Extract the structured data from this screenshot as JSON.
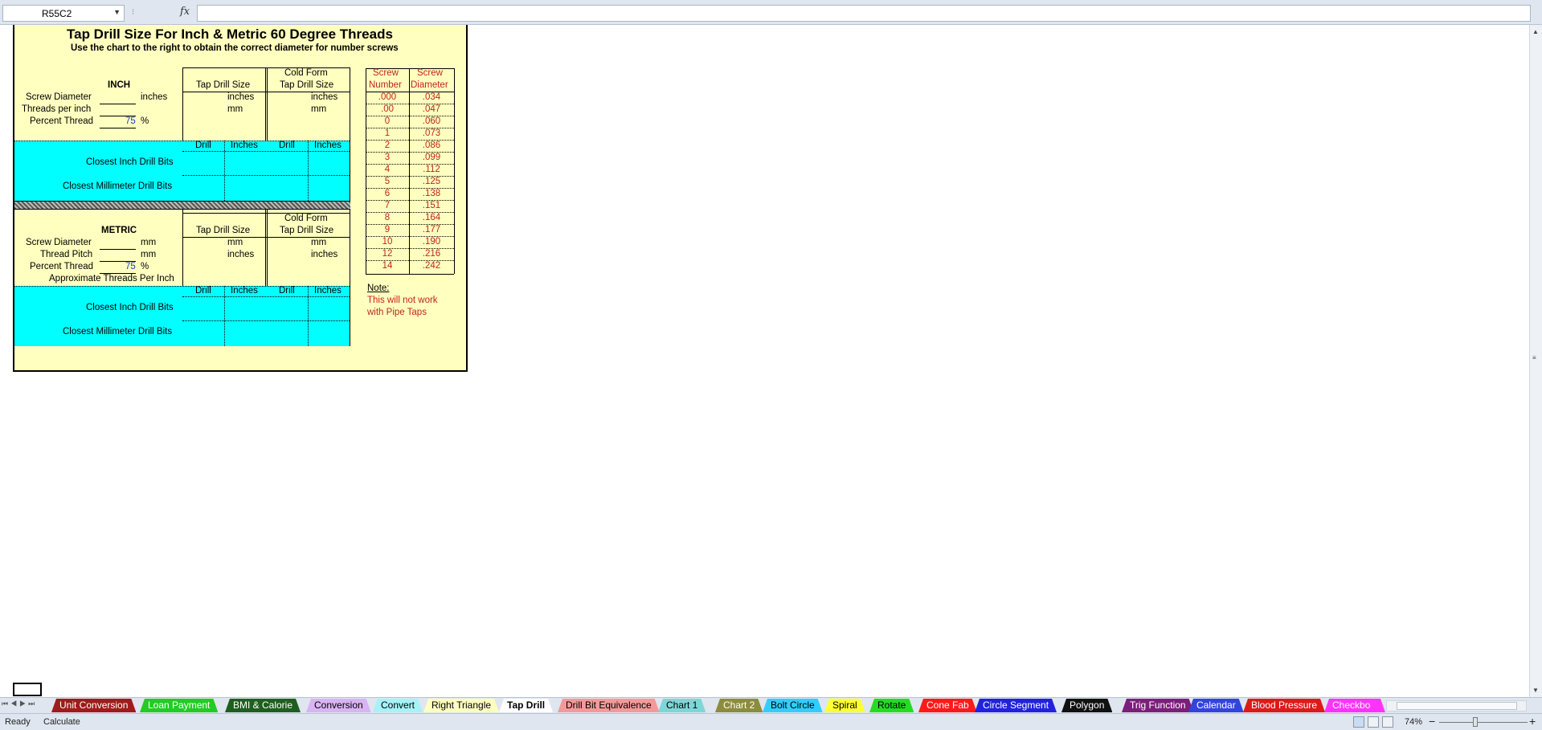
{
  "formula_bar": {
    "name_box": "R55C2",
    "fx_label": "fx",
    "formula": ""
  },
  "sheet": {
    "title": "Tap Drill Size For Inch & Metric 60 Degree Threads",
    "subtitle": "Use the chart to the right to obtain the correct diameter for number screws",
    "inch": {
      "heading": "INCH",
      "screw_diameter_label": "Screw Diameter",
      "screw_diameter_unit": "inches",
      "threads_per_inch_label": "Threads per inch",
      "percent_thread_label": "Percent Thread",
      "percent_thread_value": "75",
      "percent_unit": "%",
      "col_tap_drill": "Tap Drill Size",
      "col_cold_form_1": "Cold Form",
      "col_cold_form_2": "Tap Drill Size",
      "tap_unit_1": "inches",
      "tap_unit_2": "mm",
      "cold_unit_1": "inches",
      "cold_unit_2": "mm",
      "drill": "Drill",
      "inches": "Inches",
      "closest_inch": "Closest Inch Drill Bits",
      "closest_mm": "Closest Millimeter Drill Bits"
    },
    "metric": {
      "heading": "METRIC",
      "screw_diameter_label": "Screw Diameter",
      "screw_diameter_unit": "mm",
      "thread_pitch_label": "Thread Pitch",
      "thread_pitch_unit": "mm",
      "percent_thread_label": "Percent Thread",
      "percent_thread_value": "75",
      "percent_unit": "%",
      "approx_tpi": "Approximate Threads Per Inch",
      "col_tap_drill": "Tap Drill Size",
      "col_cold_form_1": "Cold Form",
      "col_cold_form_2": "Tap Drill Size",
      "tap_unit_1": "mm",
      "tap_unit_2": "inches",
      "cold_unit_1": "mm",
      "cold_unit_2": "inches",
      "drill": "Drill",
      "inches": "Inches",
      "closest_inch": "Closest Inch Drill Bits",
      "closest_mm": "Closest Millimeter Drill Bits"
    },
    "screw_table": {
      "header_number_1": "Screw",
      "header_number_2": "Number",
      "header_diameter_1": "Screw",
      "header_diameter_2": "Diameter",
      "rows": [
        {
          "number": ".000",
          "diameter": ".034"
        },
        {
          "number": ".00",
          "diameter": ".047"
        },
        {
          "number": "0",
          "diameter": ".060"
        },
        {
          "number": "1",
          "diameter": ".073"
        },
        {
          "number": "2",
          "diameter": ".086"
        },
        {
          "number": "3",
          "diameter": ".099"
        },
        {
          "number": "4",
          "diameter": ".112"
        },
        {
          "number": "5",
          "diameter": ".125"
        },
        {
          "number": "6",
          "diameter": ".138"
        },
        {
          "number": "7",
          "diameter": ".151"
        },
        {
          "number": "8",
          "diameter": ".164"
        },
        {
          "number": "9",
          "diameter": ".177"
        },
        {
          "number": "10",
          "diameter": ".190"
        },
        {
          "number": "12",
          "diameter": ".216"
        },
        {
          "number": "14",
          "diameter": ".242"
        }
      ]
    },
    "note_label": "Note:",
    "note_line_1": "This will not work",
    "note_line_2": "with Pipe Taps"
  },
  "tabs": [
    {
      "label": "Unit Conversion",
      "bg": "#a01b1b",
      "fg": "#ffffff"
    },
    {
      "label": "Loan Payment",
      "bg": "#22cc22",
      "fg": "#ffffff"
    },
    {
      "label": "BMI & Calorie",
      "bg": "#1f5e1f",
      "fg": "#ffffff"
    },
    {
      "label": "Conversion",
      "bg": "#d9b3f2",
      "fg": "#000000"
    },
    {
      "label": "Convert",
      "bg": "#a6f2f7",
      "fg": "#000000"
    },
    {
      "label": "Right Triangle",
      "bg": "#ffffc0",
      "fg": "#000000"
    },
    {
      "label": "Tap Drill",
      "bg": "#ffffff",
      "fg": "#000000",
      "active": true
    },
    {
      "label": "Drill Bit Equivalence",
      "bg": "#f29a9a",
      "fg": "#000000"
    },
    {
      "label": "Chart 1",
      "bg": "#7fd6d6",
      "fg": "#000000"
    },
    {
      "label": "Chart 2",
      "bg": "#8c8c3c",
      "fg": "#ffffff"
    },
    {
      "label": "Bolt Circle",
      "bg": "#33ccff",
      "fg": "#000000"
    },
    {
      "label": "Spiral",
      "bg": "#ffff33",
      "fg": "#000000"
    },
    {
      "label": "Rotate",
      "bg": "#22dd22",
      "fg": "#000000"
    },
    {
      "label": "Cone Fab",
      "bg": "#ff1a1a",
      "fg": "#ffffff"
    },
    {
      "label": "Circle Segment",
      "bg": "#2222dd",
      "fg": "#ffffff"
    },
    {
      "label": "Polygon",
      "bg": "#111111",
      "fg": "#ffffff"
    },
    {
      "label": "Trig Function",
      "bg": "#7a1f7a",
      "fg": "#ffffff"
    },
    {
      "label": "Calendar",
      "bg": "#3344dd",
      "fg": "#ffffff"
    },
    {
      "label": "Blood Pressure",
      "bg": "#dd1a1a",
      "fg": "#ffffff"
    },
    {
      "label": "Checkbo",
      "bg": "#ff33ff",
      "fg": "#ffffff"
    }
  ],
  "status": {
    "ready": "Ready",
    "calculate": "Calculate",
    "zoom": "74%",
    "zoom_minus": "−",
    "zoom_plus": "+"
  }
}
